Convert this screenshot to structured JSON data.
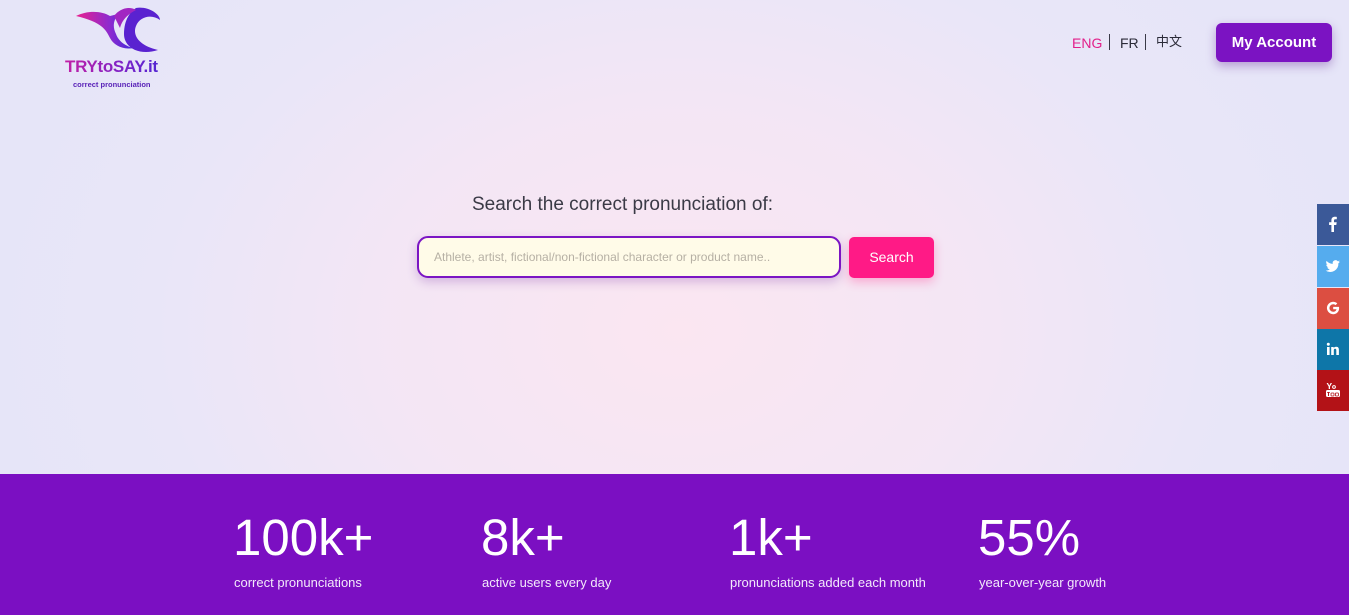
{
  "brand": {
    "name": "TRYtoSAY.it",
    "tagline": "correct pronunciation"
  },
  "header": {
    "languages": [
      {
        "label": "ENG",
        "active": true
      },
      {
        "label": "FR",
        "active": false
      },
      {
        "label": "中文",
        "active": false
      }
    ],
    "account_button": "My Account"
  },
  "search": {
    "heading": "Search the correct pronunciation of:",
    "placeholder": "Athlete, artist, fictional/non-fictional character or product name..",
    "value": "",
    "button": "Search"
  },
  "social": [
    {
      "name": "facebook-icon",
      "color": "#3b5998"
    },
    {
      "name": "twitter-icon",
      "color": "#55acee"
    },
    {
      "name": "google-icon",
      "color": "#dc4e41"
    },
    {
      "name": "linkedin-icon",
      "color": "#0e76a8"
    },
    {
      "name": "youtube-icon",
      "color": "#b31217"
    }
  ],
  "stats": [
    {
      "value": "100k+",
      "label": "correct pronunciations"
    },
    {
      "value": "8k+",
      "label": "active users every day"
    },
    {
      "value": "1k+",
      "label": "pronunciations added each month"
    },
    {
      "value": "55%",
      "label": "year-over-year growth"
    }
  ],
  "colors": {
    "accent_purple": "#7b13c2",
    "accent_pink": "#ff1a86",
    "stats_background": "#7b0fc2"
  }
}
